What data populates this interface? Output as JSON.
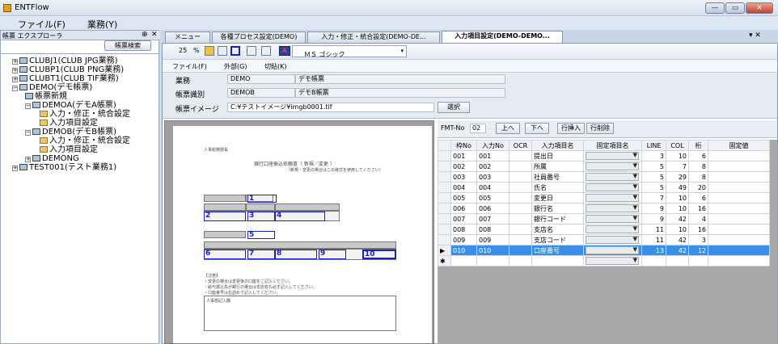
{
  "app": {
    "title": "ENTFlow"
  },
  "window_buttons": {
    "min": "—",
    "max": "▭",
    "close": "✕"
  },
  "menu": {
    "file": "ファイル(F)",
    "business": "業務(Y)"
  },
  "left": {
    "title": "帳票 エクスプローラ",
    "pin": "⊕",
    "close": "✕",
    "search_btn": "帳票検索",
    "tree": [
      "CLUBJ1(CLUB JPG業務)",
      "CLUBP1(CLUB PNG業務)",
      "CLUBT1(CLUB TIF業務)",
      "DEMO(デモ帳票)",
      "帳票新規",
      "DEMOA(デモA帳票)",
      "入力・修正・統合設定",
      "入力項目設定",
      "DEMOB(デモB帳票)",
      "入力・修正・統合設定",
      "入力項目設定",
      "DEMONG",
      "TEST001(テスト業務1)"
    ]
  },
  "tabs": [
    "メニュー",
    "各種プロセス設定(DEMO)",
    "入力・修正・統合設定(DEMO-DE...",
    "入力項目設定(DEMO-DEMO..."
  ],
  "tabctrl": "▾ ✕",
  "toolbar": {
    "zoom1": "25",
    "zoom2": "%",
    "font": "ＭＳ ゴシック",
    "font_dd": "▾"
  },
  "submenu": {
    "file": "ファイル(F)",
    "external": "外部(G)",
    "cut": "切貼(K)"
  },
  "form": {
    "business_label": "業務",
    "business_code": "DEMO",
    "business_name": "デモ帳票",
    "form_label": "帳票識別",
    "form_code": "DEMOB",
    "form_name": "デモB帳票",
    "image_label": "帳票イメージ",
    "image_path": "C:¥テストイメージ¥imgb0001.tif",
    "select_btn": "選択"
  },
  "fmt": {
    "label": "FMT-No",
    "value": "02",
    "up": "上へ",
    "down": "下へ",
    "insert": "行挿入",
    "delete": "行削除"
  },
  "grid": {
    "headers": [
      "枠No",
      "入力No",
      "OCR",
      "入力項目名",
      "固定項目名",
      "LINE",
      "COL",
      "桁",
      "固定値"
    ],
    "rows": [
      [
        "001",
        "001",
        "",
        "提出日",
        "",
        "3",
        "10",
        "6",
        ""
      ],
      [
        "002",
        "002",
        "",
        "所属",
        "",
        "5",
        "7",
        "8",
        ""
      ],
      [
        "003",
        "003",
        "",
        "社員番号",
        "",
        "5",
        "29",
        "8",
        ""
      ],
      [
        "004",
        "004",
        "",
        "氏名",
        "",
        "5",
        "49",
        "20",
        ""
      ],
      [
        "005",
        "005",
        "",
        "変更日",
        "",
        "7",
        "10",
        "6",
        ""
      ],
      [
        "006",
        "006",
        "",
        "銀行名",
        "",
        "9",
        "10",
        "16",
        ""
      ],
      [
        "007",
        "007",
        "",
        "銀行コード",
        "",
        "9",
        "42",
        "4",
        ""
      ],
      [
        "008",
        "008",
        "",
        "支店名",
        "",
        "11",
        "10",
        "16",
        ""
      ],
      [
        "009",
        "009",
        "",
        "支店コード",
        "",
        "11",
        "42",
        "3",
        ""
      ],
      [
        "010",
        "010",
        "",
        "口座番号",
        "",
        "13",
        "42",
        "12",
        ""
      ]
    ],
    "new_row": "✱",
    "cur_row": "▶"
  },
  "paper": {
    "corner": "人事総務部長",
    "title": "銀行口座振込依頼書（ 新規／変更 ）",
    "subtitle": "（新規・変更の場合はこの様式を使用してください）",
    "note1": "【注意】",
    "note2": "・変更の場合は変更後の口座をご記入ください。",
    "note3": "・給与振込先が銀行の場合は支店名も必ず記入してください。",
    "note4": "・口座番号は右詰めで記入してください。",
    "memo": "人事部記入欄",
    "boxes": [
      "1",
      "2",
      "3",
      "4",
      "5",
      "6",
      "7",
      "8",
      "9",
      "10"
    ]
  }
}
